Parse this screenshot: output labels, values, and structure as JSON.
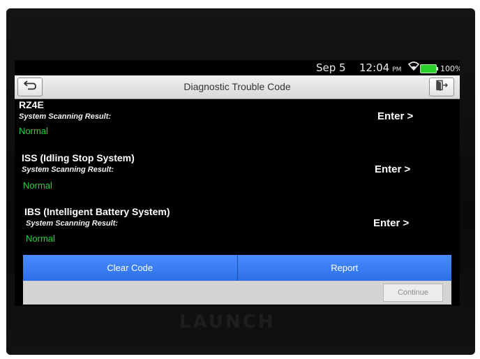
{
  "status_bar": {
    "date": "Sep 5",
    "time": "12:04",
    "ampm": "PM",
    "battery_pct": "100%",
    "battery_color": "#2bd12b"
  },
  "header": {
    "title": "Diagnostic Trouble Code",
    "back_icon": "back-arrow-icon",
    "exit_icon": "exit-icon"
  },
  "systems": [
    {
      "name": "RZ4E",
      "label": "System Scanning Result:",
      "status": "Normal",
      "action": "Enter >"
    },
    {
      "name": "ISS (Idling Stop System)",
      "label": "System Scanning Result:",
      "status": "Normal",
      "action": "Enter >"
    },
    {
      "name": "IBS (Intelligent Battery System)",
      "label": "System Scanning Result:",
      "status": "Normal",
      "action": "Enter >"
    }
  ],
  "actions": {
    "clear_code": "Clear Code",
    "report": "Report",
    "continue": "Continue"
  },
  "device": {
    "logo": "LAUNCH"
  },
  "colors": {
    "accent": "#3a7cf0",
    "status_ok": "#27d13c",
    "background": "#000000"
  }
}
